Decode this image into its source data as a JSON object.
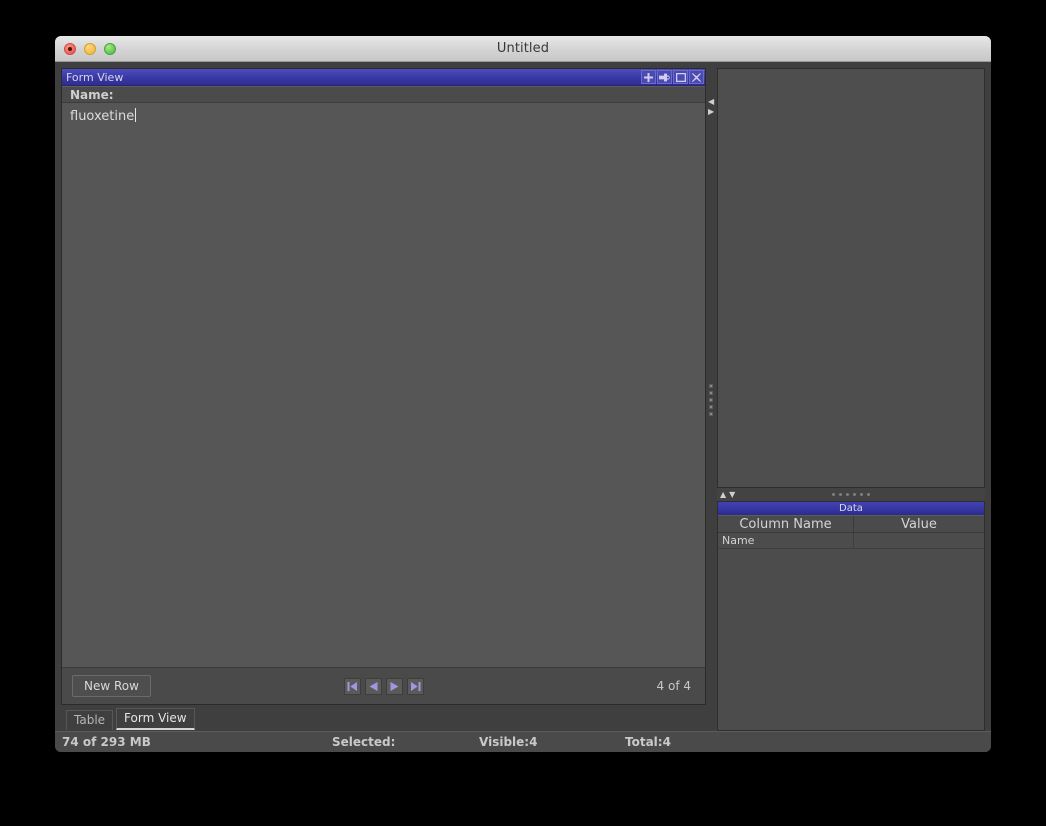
{
  "window": {
    "title": "Untitled",
    "traffic_lights": [
      "close",
      "minimize",
      "maximize"
    ]
  },
  "mdi": {
    "title": "Form View",
    "buttons": [
      {
        "name": "add-button",
        "icon": "plus-icon"
      },
      {
        "name": "detach-button",
        "icon": "pin-icon"
      },
      {
        "name": "maximize-button",
        "icon": "maximize-icon"
      },
      {
        "name": "close-button",
        "icon": "close-icon"
      }
    ]
  },
  "form": {
    "field_label": "Name:",
    "field_value": "fluoxetine"
  },
  "footer": {
    "new_row_label": "New Row",
    "nav_buttons": [
      {
        "name": "first-record-button",
        "icon": "skip-first-icon"
      },
      {
        "name": "previous-record-button",
        "icon": "previous-icon"
      },
      {
        "name": "next-record-button",
        "icon": "next-icon"
      },
      {
        "name": "last-record-button",
        "icon": "skip-last-icon"
      }
    ],
    "record_counter": "4 of 4"
  },
  "tabs": [
    {
      "label": "Table",
      "active": false
    },
    {
      "label": "Form View",
      "active": true
    }
  ],
  "splitters": {
    "vertical": {
      "collapse_left_icon": "chevron-left-icon",
      "collapse_right_icon": "chevron-right-icon",
      "grip_dots": 5
    },
    "horizontal": {
      "collapse_up_icon": "chevron-up-icon",
      "collapse_down_icon": "chevron-down-icon",
      "grip_dots": 6
    }
  },
  "data_panel": {
    "title": "Data",
    "columns": [
      "Column Name",
      "Value"
    ],
    "rows": [
      {
        "column_name": "Name",
        "value": ""
      }
    ]
  },
  "statusbar": {
    "memory": "74 of 293 MB",
    "selected": "Selected:",
    "visible": "Visible:4",
    "total": "Total:4"
  },
  "colors": {
    "window_bg": "#3f3f3f",
    "titlebar_accent": "#3a3aa8",
    "panel_bg": "#4e4e4e",
    "text": "#d4d4d4",
    "nav_arrow": "#a296e0"
  }
}
